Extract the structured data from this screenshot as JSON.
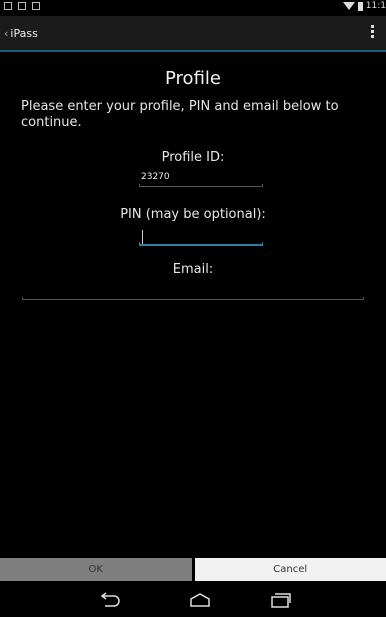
{
  "status_bar": {
    "time": "11:1"
  },
  "action_bar": {
    "title": "iPass"
  },
  "profile_form": {
    "heading": "Profile",
    "instructions": "Please enter your profile, PIN and email below to continue.",
    "profile_id_label": "Profile ID:",
    "profile_id_value": "23270",
    "pin_label": "PIN (may be optional):",
    "pin_value": "",
    "email_label": "Email:",
    "email_value": ""
  },
  "buttons": {
    "ok": "OK",
    "cancel": "Cancel"
  },
  "icons": {
    "back": "chevron-left-icon",
    "overflow": "more-vert-icon",
    "wifi": "wifi-icon",
    "battery": "battery-icon",
    "nav_back": "back-arrow-icon",
    "nav_home": "home-icon",
    "nav_recents": "recents-icon"
  },
  "colors": {
    "accent": "#2a7ea8",
    "ok_button": "#7f7f7f",
    "cancel_button": "#f2f2f2"
  }
}
